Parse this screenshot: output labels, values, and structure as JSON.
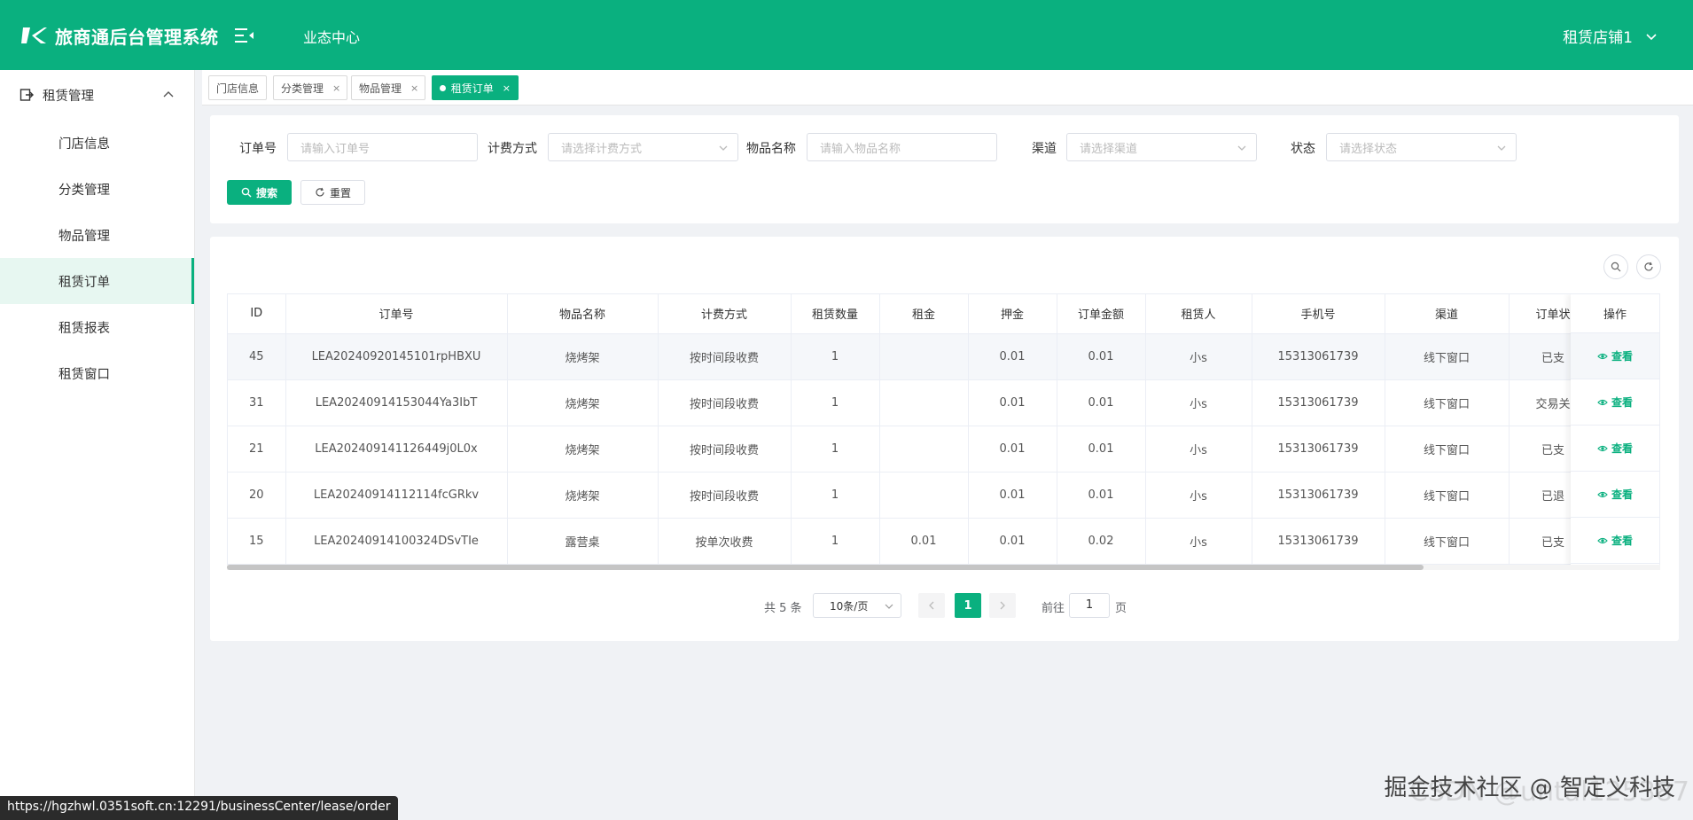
{
  "header": {
    "app_title": "旅商通后台管理系统",
    "nav_label": "业态中心",
    "store_name": "租赁店铺1",
    "brand_color": "#0ab07f"
  },
  "sidebar": {
    "group_label": "租赁管理",
    "items": [
      {
        "label": "门店信息"
      },
      {
        "label": "分类管理"
      },
      {
        "label": "物品管理"
      },
      {
        "label": "租赁订单",
        "active": true
      },
      {
        "label": "租赁报表"
      },
      {
        "label": "租赁窗口"
      }
    ]
  },
  "tabs": [
    {
      "label": "门店信息",
      "closable": false
    },
    {
      "label": "分类管理",
      "closable": true
    },
    {
      "label": "物品管理",
      "closable": true
    },
    {
      "label": "租赁订单",
      "closable": true,
      "active": true
    }
  ],
  "filters": {
    "order_no": {
      "label": "订单号",
      "placeholder": "请输入订单号"
    },
    "billing": {
      "label": "计费方式",
      "placeholder": "请选择计费方式"
    },
    "item_name": {
      "label": "物品名称",
      "placeholder": "请输入物品名称"
    },
    "channel": {
      "label": "渠道",
      "placeholder": "请选择渠道"
    },
    "status": {
      "label": "状态",
      "placeholder": "请选择状态"
    },
    "search_label": "搜索",
    "reset_label": "重置"
  },
  "table": {
    "columns": [
      "ID",
      "订单号",
      "物品名称",
      "计费方式",
      "租赁数量",
      "租金",
      "押金",
      "订单金额",
      "租赁人",
      "手机号",
      "渠道",
      "订单状"
    ],
    "action_column": "操作",
    "action_label": "查看",
    "rows": [
      {
        "id": "45",
        "order_no": "LEA20240920145101rpHBXU",
        "item": "烧烤架",
        "billing": "按时间段收费",
        "qty": "1",
        "rent": "",
        "deposit": "0.01",
        "amount": "0.01",
        "renter": "小s",
        "phone": "15313061739",
        "channel": "线下窗口",
        "status": "已支"
      },
      {
        "id": "31",
        "order_no": "LEA20240914153044Ya3IbT",
        "item": "烧烤架",
        "billing": "按时间段收费",
        "qty": "1",
        "rent": "",
        "deposit": "0.01",
        "amount": "0.01",
        "renter": "小s",
        "phone": "15313061739",
        "channel": "线下窗口",
        "status": "交易关"
      },
      {
        "id": "21",
        "order_no": "LEA202409141126449j0L0x",
        "item": "烧烤架",
        "billing": "按时间段收费",
        "qty": "1",
        "rent": "",
        "deposit": "0.01",
        "amount": "0.01",
        "renter": "小s",
        "phone": "15313061739",
        "channel": "线下窗口",
        "status": "已支"
      },
      {
        "id": "20",
        "order_no": "LEA20240914112114fcGRkv",
        "item": "烧烤架",
        "billing": "按时间段收费",
        "qty": "1",
        "rent": "",
        "deposit": "0.01",
        "amount": "0.01",
        "renter": "小s",
        "phone": "15313061739",
        "channel": "线下窗口",
        "status": "已退"
      },
      {
        "id": "15",
        "order_no": "LEA20240914100324DSvTIe",
        "item": "露营桌",
        "billing": "按单次收费",
        "qty": "1",
        "rent": "0.01",
        "deposit": "0.01",
        "amount": "0.02",
        "renter": "小s",
        "phone": "15313061739",
        "channel": "线下窗口",
        "status": "已支"
      }
    ]
  },
  "pagination": {
    "total_text": "共 5 条",
    "page_size": "10条/页",
    "current_page": "1",
    "goto_label": "前往",
    "goto_value": "1",
    "goto_unit": "页"
  },
  "status_url": "https://hgzhwl.0351soft.cn:12291/businessCenter/lease/order",
  "watermark": "掘金技术社区 @ 智定义科技",
  "watermark_ghost": "CSDN @untal125387"
}
